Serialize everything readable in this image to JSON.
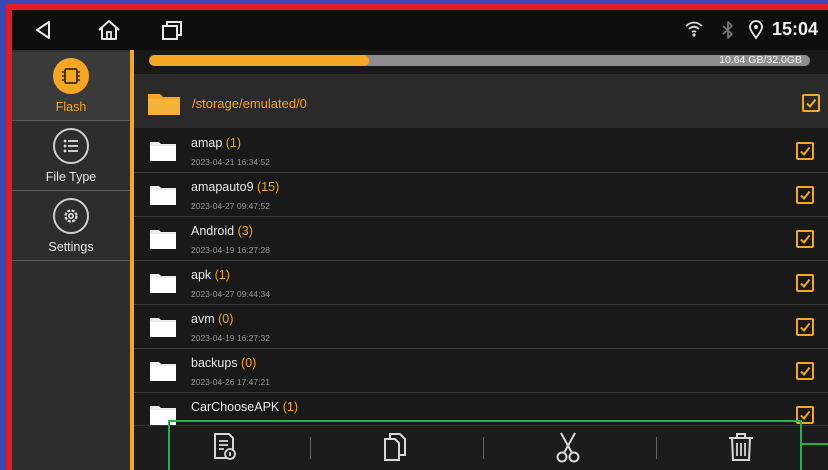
{
  "status": {
    "time": "15:04",
    "icons": [
      "back-icon",
      "home-icon",
      "recents-icon",
      "wifi-icon",
      "bluetooth-icon",
      "location-icon"
    ]
  },
  "sidebar": {
    "items": [
      {
        "label": "Flash",
        "icon": "chip-icon",
        "active": true
      },
      {
        "label": "File Type",
        "icon": "list-icon",
        "active": false
      },
      {
        "label": "Settings",
        "icon": "gear-icon",
        "active": false
      }
    ]
  },
  "storage": {
    "text": "10.64 GB/32.0GB",
    "used_fraction": 0.3325
  },
  "path": "/storage/emulated/0",
  "files": [
    {
      "name": "amap",
      "count": "(1)",
      "date": "2023-04-21 16:34:52",
      "checked": true
    },
    {
      "name": "amapauto9",
      "count": "(15)",
      "date": "2023-04-27 09:47:52",
      "checked": true
    },
    {
      "name": "Android",
      "count": "(3)",
      "date": "2023-04-19 16:27:28",
      "checked": true
    },
    {
      "name": "apk",
      "count": "(1)",
      "date": "2023-04-27 09:44:34",
      "checked": true
    },
    {
      "name": "avm",
      "count": "(0)",
      "date": "2023-04-19 16:27:32",
      "checked": true
    },
    {
      "name": "backups",
      "count": "(0)",
      "date": "2023-04-26 17:47:21",
      "checked": true
    },
    {
      "name": "CarChooseAPK",
      "count": "(1)",
      "date": "",
      "checked": true
    }
  ],
  "toolbar": {
    "buttons": [
      "file-info-icon",
      "copy-icon",
      "cut-icon",
      "delete-icon"
    ]
  },
  "colors": {
    "accent": "#f5a623",
    "highlight_box": "#1fb548",
    "frame_red": "#e01c24",
    "frame_blue": "#3b49b6"
  }
}
